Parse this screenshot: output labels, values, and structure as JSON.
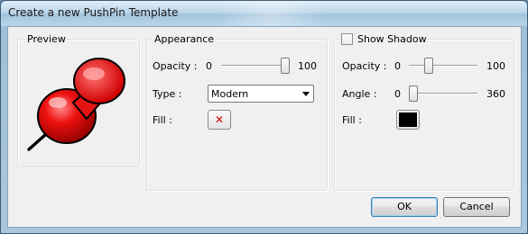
{
  "window": {
    "title": "Create a new PushPin Template"
  },
  "preview": {
    "legend": "Preview",
    "image_icon": "pushpin-icon"
  },
  "appearance": {
    "legend": "Appearance",
    "opacity": {
      "label": "Opacity :",
      "min": "0",
      "max": "100",
      "value": 100
    },
    "type": {
      "label": "Type :",
      "selected": "Modern"
    },
    "fill": {
      "label": "Fill :",
      "state": "none",
      "icon": "red-x-icon"
    }
  },
  "shadow": {
    "checkbox_label": "Show Shadow",
    "checked": false,
    "opacity": {
      "label": "Opacity :",
      "min": "0",
      "max": "100",
      "value": 25
    },
    "angle": {
      "label": "Angle :",
      "min": "0",
      "max": "360",
      "value": 0
    },
    "fill": {
      "label": "Fill :",
      "color": "#000000"
    }
  },
  "buttons": {
    "ok": "OK",
    "cancel": "Cancel"
  }
}
